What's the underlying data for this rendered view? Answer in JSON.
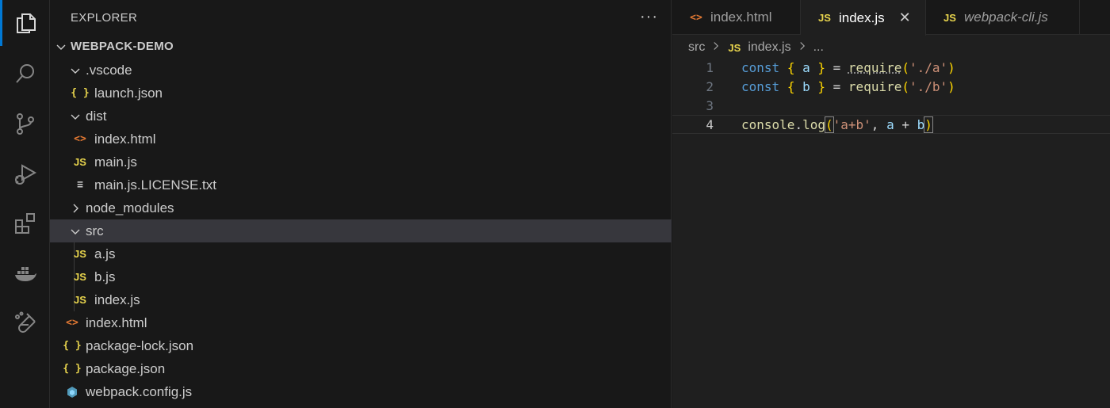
{
  "explorer": {
    "title": "EXPLORER",
    "more_label": "···",
    "root": "WEBPACK-DEMO",
    "rows": [
      {
        "label": ".vscode",
        "kind": "folder-open"
      },
      {
        "label": "launch.json",
        "kind": "json"
      },
      {
        "label": "dist",
        "kind": "folder-open"
      },
      {
        "label": "index.html",
        "kind": "html"
      },
      {
        "label": "main.js",
        "kind": "js"
      },
      {
        "label": "main.js.LICENSE.txt",
        "kind": "txt"
      },
      {
        "label": "node_modules",
        "kind": "folder-closed"
      },
      {
        "label": "src",
        "kind": "folder-open"
      },
      {
        "label": "a.js",
        "kind": "js"
      },
      {
        "label": "b.js",
        "kind": "js"
      },
      {
        "label": "index.js",
        "kind": "js"
      },
      {
        "label": "index.html",
        "kind": "html"
      },
      {
        "label": "package-lock.json",
        "kind": "json"
      },
      {
        "label": "package.json",
        "kind": "json"
      },
      {
        "label": "webpack.config.js",
        "kind": "config"
      }
    ]
  },
  "icons": {
    "js": "JS",
    "json": "{ }",
    "html": "<>",
    "txt": "≡"
  },
  "tabs": [
    {
      "label": "index.html",
      "icon": "html-file-icon"
    },
    {
      "label": "index.js",
      "icon": "js-file-icon",
      "active": true,
      "close": "✕"
    },
    {
      "label": "webpack-cli.js",
      "icon": "js-file-icon",
      "preview": true
    }
  ],
  "breadcrumb": {
    "folder": "src",
    "file": "index.js",
    "more": "..."
  },
  "code": {
    "lines": [
      {
        "n": "1",
        "tokens": [
          [
            "k",
            "const"
          ],
          [
            "p",
            " "
          ],
          [
            "b",
            "{"
          ],
          [
            "p",
            " "
          ],
          [
            "v",
            "a"
          ],
          [
            "p",
            " "
          ],
          [
            "b",
            "}"
          ],
          [
            "p",
            " = "
          ],
          [
            "fd",
            "require"
          ],
          [
            "b",
            "("
          ],
          [
            "s",
            "'./a'"
          ],
          [
            "b",
            ")"
          ]
        ]
      },
      {
        "n": "2",
        "tokens": [
          [
            "k",
            "const"
          ],
          [
            "p",
            " "
          ],
          [
            "b",
            "{"
          ],
          [
            "p",
            " "
          ],
          [
            "v",
            "b"
          ],
          [
            "p",
            " "
          ],
          [
            "b",
            "}"
          ],
          [
            "p",
            " = "
          ],
          [
            "f",
            "require"
          ],
          [
            "b",
            "("
          ],
          [
            "s",
            "'./b'"
          ],
          [
            "b",
            ")"
          ]
        ]
      },
      {
        "n": "3",
        "tokens": []
      },
      {
        "n": "4",
        "tokens": [
          [
            "f",
            "console"
          ],
          [
            "p",
            "."
          ],
          [
            "f",
            "log"
          ],
          [
            "bh",
            "("
          ],
          [
            "s",
            "'a+b'"
          ],
          [
            "p",
            ", "
          ],
          [
            "v",
            "a"
          ],
          [
            "p",
            " + "
          ],
          [
            "v",
            "b"
          ],
          [
            "bh",
            ")"
          ]
        ]
      }
    ],
    "current_line": "4"
  },
  "colors": {
    "accent": "#0078d4",
    "js_icon": "#e8d44d",
    "html_icon": "#e37933",
    "config_icon": "#519aba"
  }
}
